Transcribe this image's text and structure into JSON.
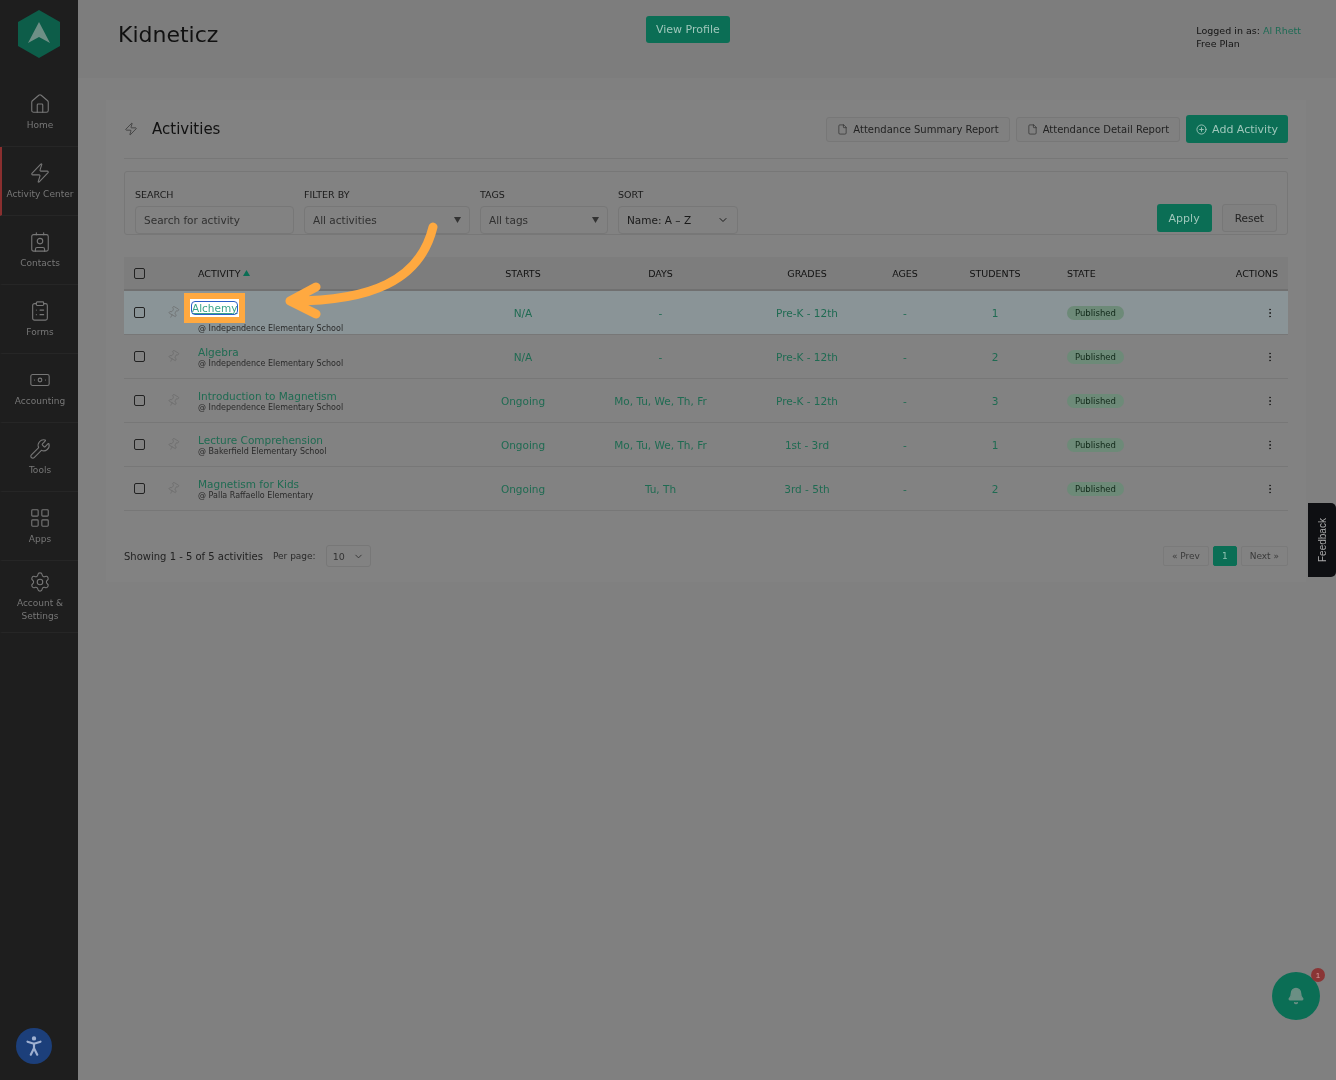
{
  "sidebar": {
    "items": [
      {
        "label": "Home",
        "selected": false
      },
      {
        "label": "Activity Center",
        "selected": true
      },
      {
        "label": "Contacts",
        "selected": false
      },
      {
        "label": "Forms",
        "selected": false
      },
      {
        "label": "Accounting",
        "selected": false
      },
      {
        "label": "Tools",
        "selected": false
      },
      {
        "label": "Apps",
        "selected": false
      },
      {
        "label": "Account & Settings",
        "selected": false
      }
    ]
  },
  "header": {
    "title": "Kidneticz",
    "profile_button": "View Profile",
    "logged_in_label": "Logged in as:",
    "user": "Al Rhett",
    "plan": "Free Plan"
  },
  "activities": {
    "title": "Activities",
    "buttons": [
      {
        "label": "Attendance Summary Report",
        "kind": "report"
      },
      {
        "label": "Attendance Detail Report",
        "kind": "report"
      },
      {
        "label": "Add Activity",
        "kind": "primary"
      }
    ],
    "filters": {
      "search": {
        "label": "SEARCH",
        "placeholder": "Search for activity"
      },
      "filter_by": {
        "label": "FILTER BY",
        "placeholder": "All activities"
      },
      "tags": {
        "label": "TAGS",
        "placeholder": "All tags"
      },
      "sort": {
        "label": "SORT",
        "value": "Name: A – Z"
      },
      "apply": "Apply",
      "reset": "Reset"
    },
    "table": {
      "columns": [
        {
          "label": "ACTIVITY",
          "sorted": true
        },
        {
          "label": "STARTS",
          "sorted": false
        },
        {
          "label": "DAYS",
          "sorted": false
        },
        {
          "label": "GRADES",
          "sorted": false
        },
        {
          "label": "AGES",
          "sorted": false
        },
        {
          "label": "STUDENTS",
          "sorted": false
        },
        {
          "label": "STATE",
          "sorted": false
        },
        {
          "label": "ACTIONS",
          "sorted": false
        }
      ],
      "all_checked": false,
      "rows": [
        {
          "name": "Alchemy",
          "location": "@ Independence Elementary School",
          "starts": "N/A",
          "days": "-",
          "grades": "Pre-K - 12th",
          "ages": "-",
          "students": "1",
          "state": "Published",
          "checked": false,
          "selected": true,
          "callout": true
        },
        {
          "name": "Algebra",
          "location": "@ Independence Elementary School",
          "starts": "N/A",
          "days": "-",
          "grades": "Pre-K - 12th",
          "ages": "-",
          "students": "2",
          "state": "Published",
          "checked": false,
          "selected": false,
          "callout": false
        },
        {
          "name": "Introduction to Magnetism",
          "location": "@ Independence Elementary School",
          "starts": "Ongoing",
          "days": "Mo, Tu, We, Th, Fr",
          "grades": "Pre-K - 12th",
          "ages": "-",
          "students": "3",
          "state": "Published",
          "checked": false,
          "selected": false,
          "callout": false
        },
        {
          "name": "Lecture Comprehension",
          "location": "@ Bakerfield Elementary School",
          "starts": "Ongoing",
          "days": "Mo, Tu, We, Th, Fr",
          "grades": "1st - 3rd",
          "ages": "-",
          "students": "1",
          "state": "Published",
          "checked": false,
          "selected": false,
          "callout": false
        },
        {
          "name": "Magnetism for Kids",
          "location": "@ Palla Raffaello Elementary",
          "starts": "Ongoing",
          "days": "Tu, Th",
          "grades": "3rd - 5th",
          "ages": "-",
          "students": "2",
          "state": "Published",
          "checked": false,
          "selected": false,
          "callout": false
        }
      ]
    },
    "footer": {
      "summary": "Showing 1 - 5 of 5 activities",
      "per_page_label": "Per page:",
      "per_page": "10",
      "pagination": [
        {
          "label": "« Prev",
          "disabled": true,
          "selected": false
        },
        {
          "label": "1",
          "disabled": false,
          "selected": true
        },
        {
          "label": "Next »",
          "disabled": true,
          "selected": false
        }
      ]
    }
  },
  "feedback_tab": "Feedback",
  "notifications": {
    "badge": "1"
  }
}
